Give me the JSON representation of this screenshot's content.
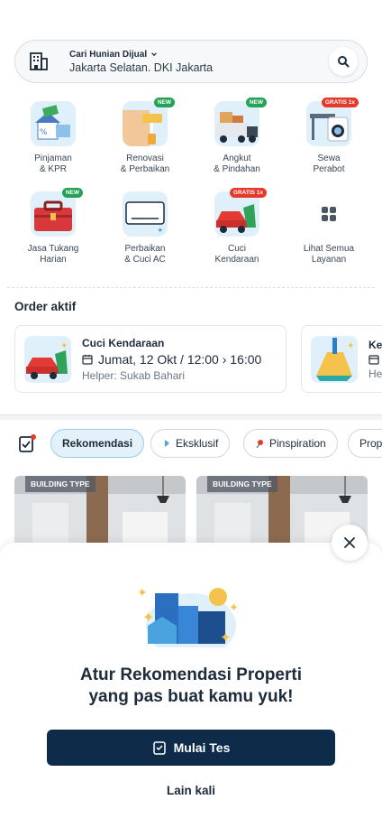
{
  "search": {
    "label": "Cari Hunian Dijual",
    "location": "Jakarta Selatan. DKI Jakarta",
    "icons": {
      "left": "building-icon",
      "right": "search-icon",
      "chevron": "chevron-down-icon"
    }
  },
  "services": [
    {
      "name": "Pinjaman\n& KPR",
      "badge": "",
      "icon": "house-money-icon"
    },
    {
      "name": "Renovasi\n& Perbaikan",
      "badge": "NEW",
      "icon": "paint-roller-icon"
    },
    {
      "name": "Angkut\n& Pindahan",
      "badge": "NEW",
      "icon": "moving-truck-icon"
    },
    {
      "name": "Sewa\nPerabot",
      "badge": "GRATIS 1x",
      "icon": "furniture-icon"
    },
    {
      "name": "Jasa Tukang\nHarian",
      "badge": "NEW",
      "icon": "toolbox-icon"
    },
    {
      "name": "Perbaikan\n& Cuci AC",
      "badge": "",
      "icon": "air-conditioner-icon"
    },
    {
      "name": "Cuci\nKendaraan",
      "badge": "GRATIS 1x",
      "icon": "car-wash-icon"
    },
    {
      "name": "Lihat Semua\nLayanan",
      "badge": "",
      "icon": "grid-icon"
    }
  ],
  "orders": {
    "title": "Order aktif",
    "items": [
      {
        "title": "Cuci Kendaraan",
        "date": "Jumat, 12 Okt / 12:00 › 16:00",
        "helper": "Helper: Sukab Bahari",
        "icon": "car-wash-icon"
      },
      {
        "title": "Keb",
        "date": "",
        "helper": "Hel",
        "icon": "cleaning-icon"
      }
    ]
  },
  "filters": {
    "icon": "checklist-icon",
    "chips": [
      "Rekomendasi",
      "Eksklusif",
      "Pinspiration",
      "Prop"
    ]
  },
  "properties": [
    {
      "tag": "BUILDING TYPE"
    },
    {
      "tag": "BUILDING TYPE"
    }
  ],
  "sheet": {
    "headline": "Atur Rekomendasi Properti\nyang pas buat kamu yuk!",
    "primary_label": "Mulai Tes",
    "secondary_label": "Lain kali"
  },
  "colors": {
    "primary": "#0e2c4a",
    "accent_light": "#e3f1fb",
    "badge_new": "#22a356",
    "badge_gratis": "#e5392b"
  }
}
